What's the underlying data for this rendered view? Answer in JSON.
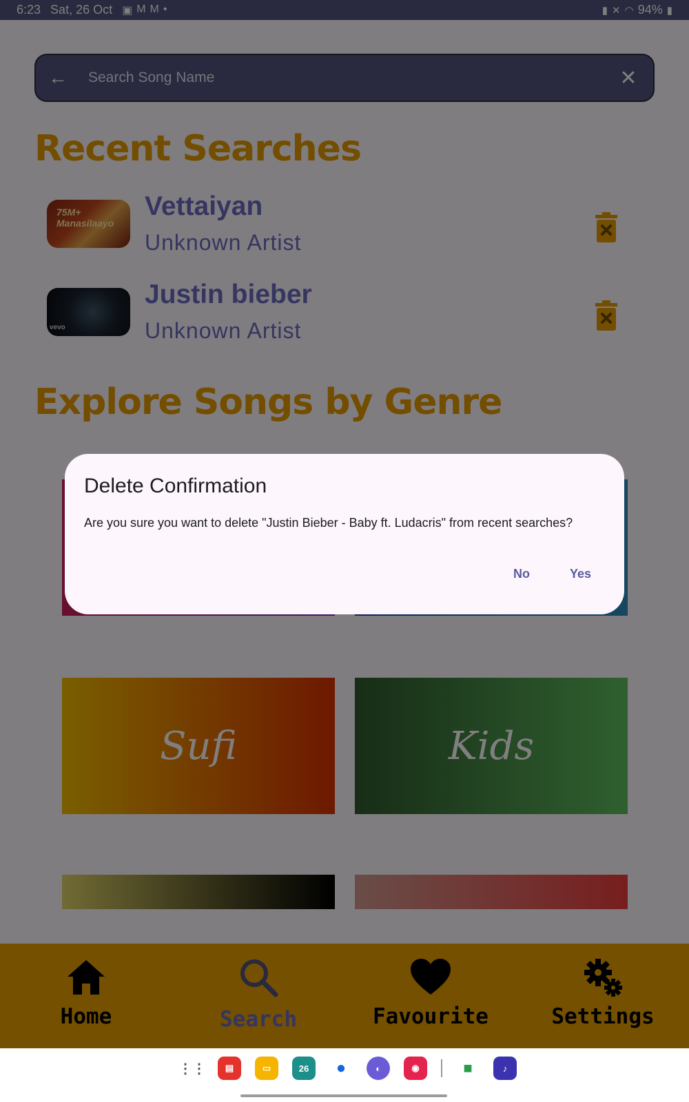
{
  "status_bar": {
    "time": "6:23",
    "date": "Sat, 26 Oct",
    "battery": "94%",
    "notification_icons": [
      "gallery-icon",
      "gmail-icon",
      "gmail-icon",
      "dot-icon"
    ],
    "system_icons": [
      "battery-saver-icon",
      "mute-icon",
      "wifi-icon",
      "battery-icon"
    ]
  },
  "search": {
    "placeholder": "Search Song Name",
    "back_icon": "arrow-left-icon",
    "clear_icon": "close-icon"
  },
  "recent": {
    "title": "Recent Searches",
    "items": [
      {
        "title": "Vettaiyan",
        "artist": "Unknown Artist",
        "thumb_caption": "75M+ Manasilaayo"
      },
      {
        "title": "Justin bieber",
        "artist": "Unknown Artist",
        "thumb_caption": "vevo"
      }
    ],
    "delete_icon": "trash-x-icon"
  },
  "genres": {
    "title": "Explore Songs by Genre",
    "tiles": [
      {
        "label": "",
        "colors": [
          "#d11f5a",
          "#7c34c7"
        ]
      },
      {
        "label": "",
        "colors": [
          "#1e4bb0",
          "#2f8fc3"
        ]
      },
      {
        "label": "Sufi",
        "colors": [
          "#f3bd00",
          "#dc3200"
        ]
      },
      {
        "label": "Kids",
        "colors": [
          "#2f5a2e",
          "#5fbf5f"
        ]
      },
      {
        "label": "",
        "colors": [
          "#e2d669",
          "#000000"
        ]
      },
      {
        "label": "",
        "colors": [
          "#d39a91",
          "#ef3d3d"
        ]
      }
    ]
  },
  "bottom_nav": {
    "items": [
      {
        "label": "Home",
        "icon": "home-icon",
        "active": false
      },
      {
        "label": "Search",
        "icon": "search-icon",
        "active": true
      },
      {
        "label": "Favourite",
        "icon": "heart-icon",
        "active": false
      },
      {
        "label": "Settings",
        "icon": "gears-icon",
        "active": false
      }
    ],
    "background": "#e8a100"
  },
  "dialog": {
    "title": "Delete Confirmation",
    "message": "Are you sure you want to delete \"Justin Bieber - Baby ft. Ludacris\" from recent searches?",
    "no_label": "No",
    "yes_label": "Yes"
  },
  "taskbar": {
    "apps": [
      "apps-grid-icon",
      "notes-app-icon",
      "files-app-icon",
      "calendar-app-icon",
      "messages-app-icon",
      "internet-app-icon",
      "camera-app-icon",
      "meet-app-icon",
      "music-app-icon"
    ],
    "calendar_day": "26"
  },
  "colors": {
    "accent": "#e69b00",
    "primary": "#6a6bc2",
    "search_bg": "#53537e"
  }
}
